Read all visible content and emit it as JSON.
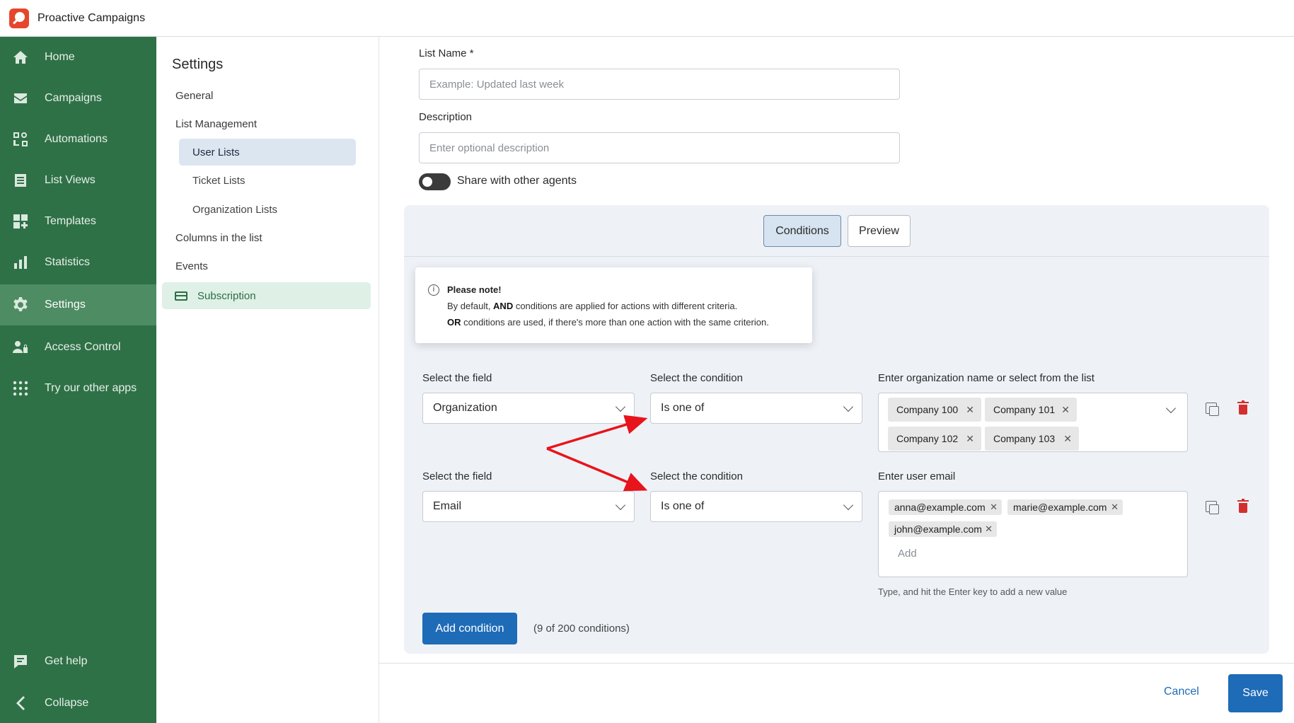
{
  "app": {
    "title": "Proactive Campaigns"
  },
  "sidebar": {
    "items": [
      {
        "label": "Home",
        "icon": "home-icon"
      },
      {
        "label": "Campaigns",
        "icon": "mail-icon"
      },
      {
        "label": "Automations",
        "icon": "automation-icon"
      },
      {
        "label": "List Views",
        "icon": "list-icon"
      },
      {
        "label": "Templates",
        "icon": "templates-icon"
      },
      {
        "label": "Statistics",
        "icon": "bar-chart-icon"
      },
      {
        "label": "Settings",
        "icon": "gear-icon",
        "active": true
      },
      {
        "label": "Access Control",
        "icon": "users-lock-icon"
      },
      {
        "label": "Try our other apps",
        "icon": "grid-icon"
      }
    ],
    "bottom": [
      {
        "label": "Get help",
        "icon": "chat-icon"
      },
      {
        "label": "Collapse",
        "icon": "chevron-left-icon"
      }
    ],
    "colors": {
      "background": "#2f7147",
      "active": "#4e8c63"
    }
  },
  "settings_nav": {
    "title": "Settings",
    "general": "General",
    "list_management": "List Management",
    "user_lists": "User Lists",
    "ticket_lists": "Ticket Lists",
    "organization_lists": "Organization Lists",
    "columns": "Columns in the list",
    "events": "Events",
    "subscription": "Subscription"
  },
  "form": {
    "list_name_label": "List Name *",
    "list_name_placeholder": "Example: Updated last week",
    "description_label": "Description",
    "description_placeholder": "Enter optional description",
    "share_label": "Share with other agents"
  },
  "tabs": {
    "conditions": "Conditions",
    "preview": "Preview"
  },
  "note": {
    "title": "Please note!",
    "line1_pre": "By default, ",
    "line1_bold": "AND",
    "line1_post": " conditions are applied for actions with different criteria.",
    "line2_bold": "OR",
    "line2_post": " conditions are used, if there's more than one action with the same criterion."
  },
  "conditions": [
    {
      "field_label": "Select the field",
      "field_value": "Organization",
      "condition_label": "Select the condition",
      "condition_value": "Is one of",
      "values_label": "Enter organization name or select from the list",
      "values": [
        "Company 100",
        "Company 101",
        "Company 102",
        "Company 103"
      ]
    },
    {
      "field_label": "Select the field",
      "field_value": "Email",
      "condition_label": "Select the condition",
      "condition_value": "Is one of",
      "values_label": "Enter user email",
      "values": [
        "anna@example.com",
        "marie@example.com",
        "john@example.com"
      ],
      "add_placeholder": "Add",
      "hint": "Type, and hit the Enter key to add a new value"
    }
  ],
  "add_condition": "Add condition",
  "condition_count": "(9 of 200 conditions)",
  "footer": {
    "cancel": "Cancel",
    "save": "Save"
  },
  "colors": {
    "primary": "#1e6bb8",
    "danger": "#d32f2f",
    "annotation_arrow": "#e8141b"
  }
}
